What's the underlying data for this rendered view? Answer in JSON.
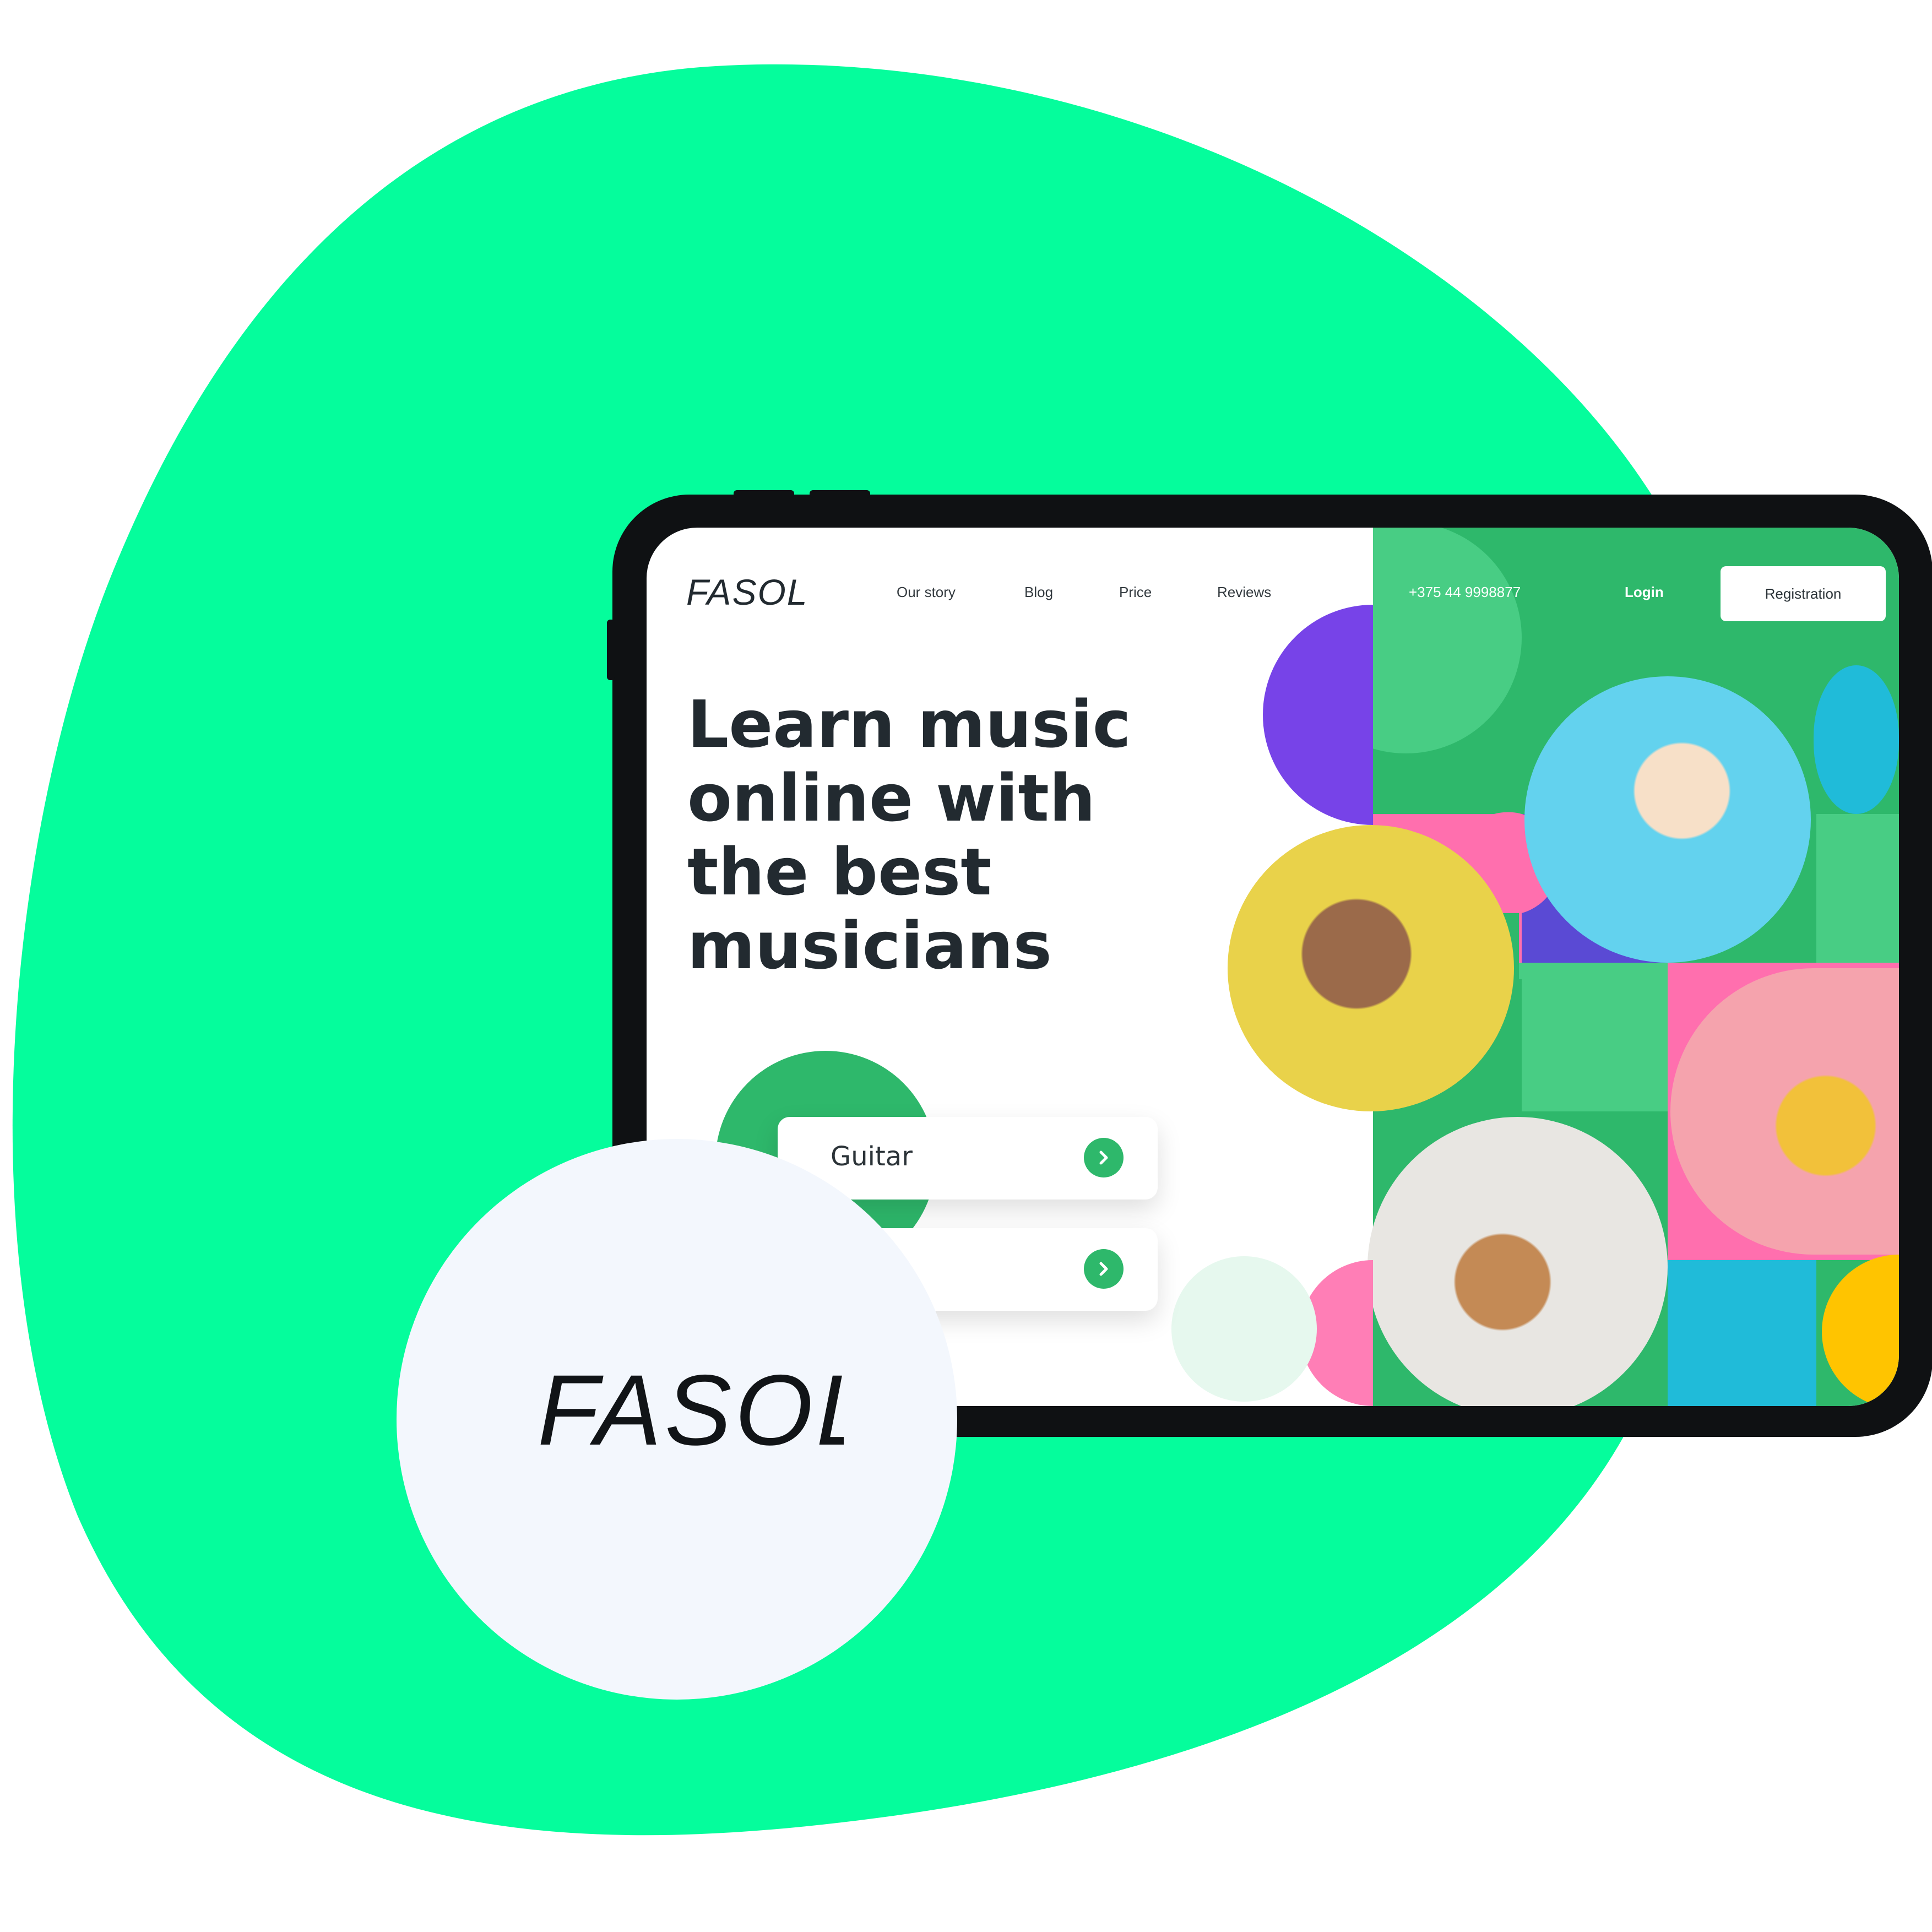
{
  "brand": {
    "name": "FASOL",
    "colors": {
      "accent": "#05fd9c",
      "green": "#2eb86b",
      "dark": "#222a30",
      "badge": "#f3f7fd"
    }
  },
  "header": {
    "nav": [
      "Our story",
      "Blog",
      "Price",
      "Reviews"
    ],
    "phone": "+375 44 9998877",
    "login": "Login",
    "registration": "Registration"
  },
  "hero": {
    "title_lines": [
      "Learn music",
      "online with",
      "the best",
      "musicians"
    ]
  },
  "instruments": [
    {
      "label": "Guitar",
      "icon": "chevron-right-icon"
    },
    {
      "label": "",
      "icon": "chevron-right-icon"
    }
  ],
  "photos": [
    "woman-with-headphones",
    "woman-peace-sign",
    "woman-with-phone",
    "man-playing-guitar"
  ]
}
